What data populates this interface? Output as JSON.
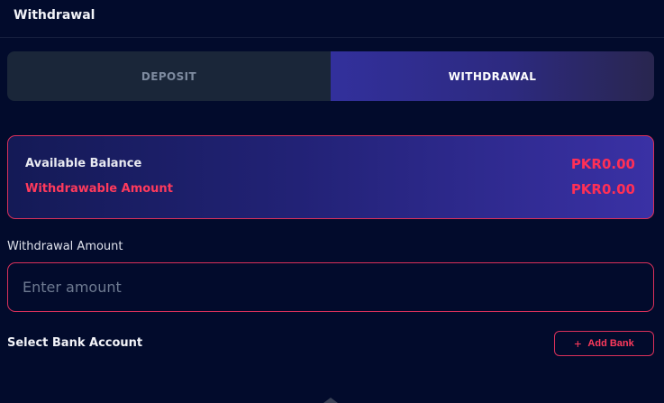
{
  "header": {
    "title": "Withdrawal"
  },
  "tabs": [
    {
      "label": "DEPOSIT",
      "active": false
    },
    {
      "label": "WITHDRAWAL",
      "active": true
    }
  ],
  "balance": {
    "available_label": "Available Balance",
    "available_value": "PKR0.00",
    "withdrawable_label": "Withdrawable Amount",
    "withdrawable_value": "PKR0.00"
  },
  "amount": {
    "label": "Withdrawal Amount",
    "placeholder": "Enter amount",
    "value": ""
  },
  "bank": {
    "label": "Select Bank Account",
    "add_button_label": "Add Bank",
    "add_button_icon": "plus-icon"
  },
  "colors": {
    "background": "#020b2c",
    "accent": "#ff2f56",
    "active_tab_gradient_start": "#32309c"
  }
}
